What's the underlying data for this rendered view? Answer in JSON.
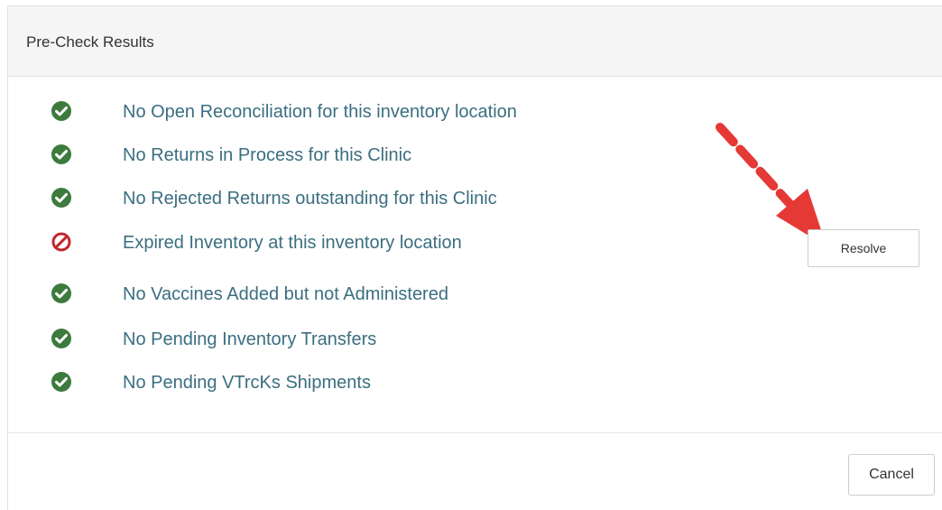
{
  "dialog": {
    "title": "Pre-Check Results"
  },
  "checks": [
    {
      "label": "No Open Reconciliation for this inventory location",
      "status": "pass",
      "icon": "check-circle-icon"
    },
    {
      "label": "No Returns in Process for this Clinic",
      "status": "pass",
      "icon": "check-circle-icon"
    },
    {
      "label": "No Rejected Returns outstanding for this Clinic",
      "status": "pass",
      "icon": "check-circle-icon"
    },
    {
      "label": "Expired Inventory at this inventory location",
      "status": "fail",
      "icon": "prohibited-icon"
    },
    {
      "label": "No Vaccines Added but not Administered",
      "status": "pass",
      "icon": "check-circle-icon"
    },
    {
      "label": "No Pending Inventory Transfers",
      "status": "pass",
      "icon": "check-circle-icon"
    },
    {
      "label": "No Pending VTrcKs Shipments",
      "status": "pass",
      "icon": "check-circle-icon"
    }
  ],
  "resolve_label": "Resolve",
  "footer": {
    "cancel_label": "Cancel"
  },
  "colors": {
    "pass": "#3d7a3d",
    "fail": "#c0282b",
    "label_text": "#3b6e80",
    "header_bg": "#f5f5f5",
    "annotation_arrow": "#e53935"
  }
}
